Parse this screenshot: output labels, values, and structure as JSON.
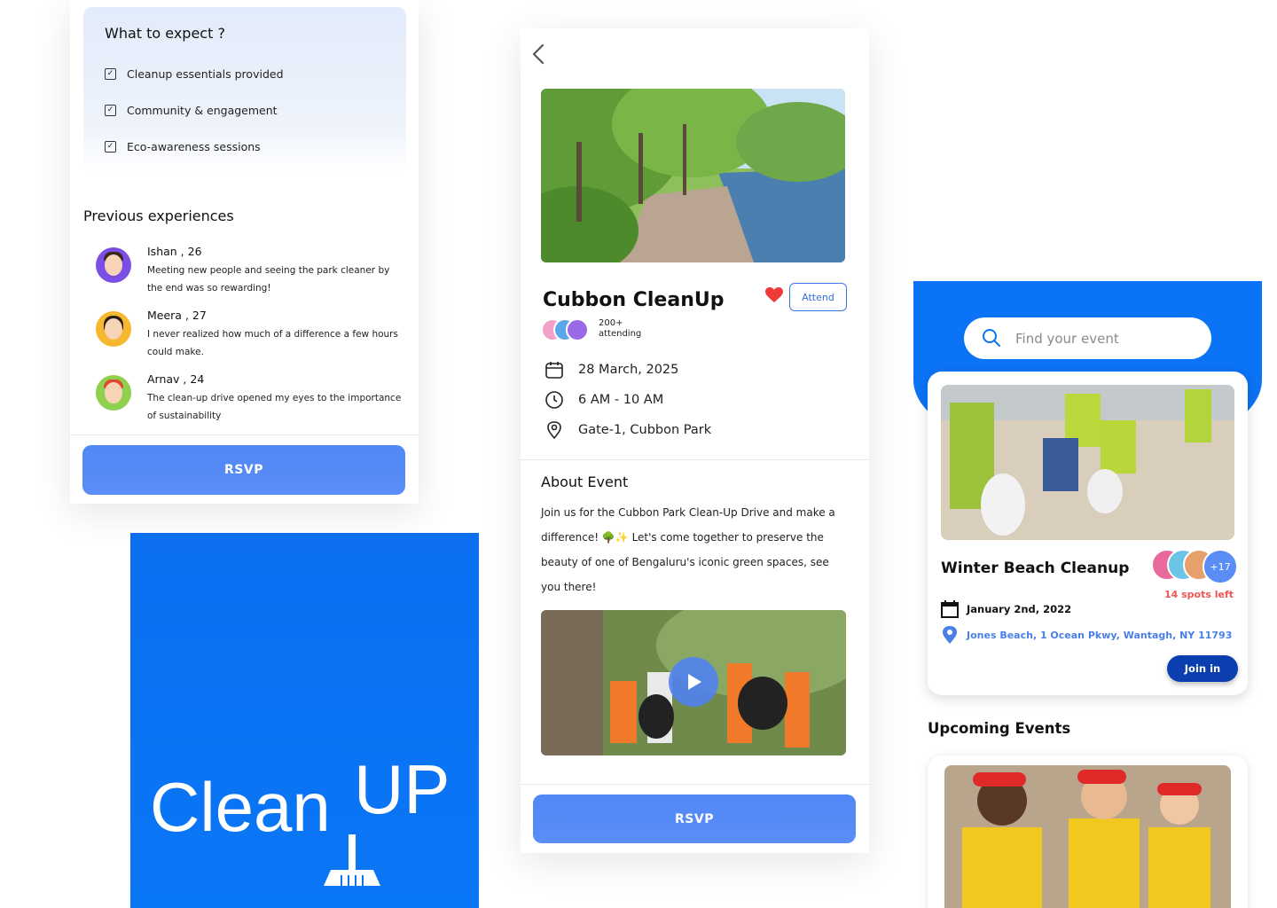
{
  "colors": {
    "primary": "#0b73f5",
    "rsvp": "#5b8df7",
    "join": "#0b3fb0",
    "spots": "#f05454",
    "link": "#4a7fe6"
  },
  "details": {
    "expect_title": "What to expect ?",
    "expect_items": [
      "Cleanup essentials provided",
      "Community & engagement",
      "Eco-awareness sessions"
    ],
    "prev_title": "Previous experiences",
    "reviews": [
      {
        "name": "Ishan , 26",
        "text": "Meeting new people and seeing the park cleaner by the end was so rewarding!"
      },
      {
        "name": "Meera , 27",
        "text": "I never realized how much of a difference a few hours could make."
      },
      {
        "name": "Arnav , 24",
        "text": "The clean-up drive opened my eyes to the importance of sustainability"
      }
    ],
    "rsvp_label": "RSVP"
  },
  "logo": {
    "text_a": "Clean",
    "text_b": "UP"
  },
  "event": {
    "title": "Cubbon CleanUp",
    "attend_label": "Attend",
    "attending_count": "200+",
    "attending_label": "attending",
    "date": "28 March, 2025",
    "time": "6 AM - 10 AM",
    "location": "Gate-1, Cubbon Park",
    "about_title": "About Event",
    "about_text": "Join us for the Cubbon Park Clean-Up Drive and make a difference! 🌳✨ Let's come together to preserve the beauty of one of Bengaluru's iconic green spaces, see you there!",
    "rsvp_label": "RSVP"
  },
  "finder": {
    "search_placeholder": "Find your event",
    "featured": {
      "title": "Winter Beach Cleanup",
      "more_count": "+17",
      "spots_left": "14 spots left",
      "date": "January 2nd, 2022",
      "location": "Jones Beach, 1 Ocean Pkwy, Wantagh, NY 11793",
      "join_label": "Join in"
    },
    "upcoming_title": "Upcoming Events"
  }
}
